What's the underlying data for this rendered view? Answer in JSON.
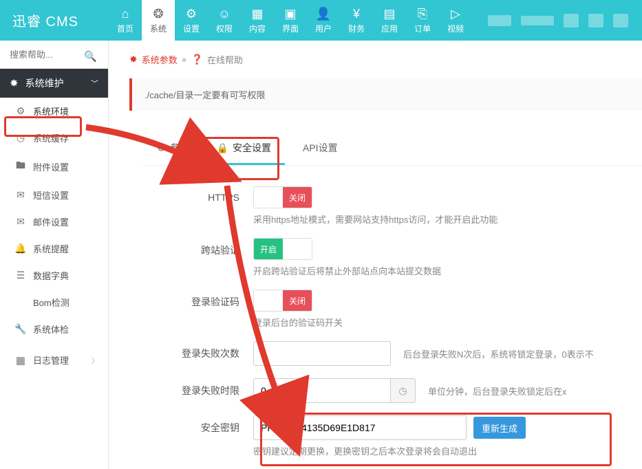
{
  "brand": "迅睿 CMS",
  "topnav": [
    {
      "icon": "⌂",
      "label": "首页"
    },
    {
      "icon": "❂",
      "label": "系统",
      "active": true
    },
    {
      "icon": "⚙",
      "label": "设置"
    },
    {
      "icon": "☺",
      "label": "权限"
    },
    {
      "icon": "▦",
      "label": "内容"
    },
    {
      "icon": "▣",
      "label": "界面"
    },
    {
      "icon": "👤",
      "label": "用户"
    },
    {
      "icon": "¥",
      "label": "财务"
    },
    {
      "icon": "▤",
      "label": "应用"
    },
    {
      "icon": "⎘",
      "label": "订单"
    },
    {
      "icon": "▷",
      "label": "视频"
    }
  ],
  "search": {
    "placeholder": "搜索帮助..."
  },
  "side_header": "系统维护",
  "sidebar_items": [
    {
      "icon": "⚙",
      "label": "系统环境",
      "active": true,
      "name": "sidebar-item-system-env"
    },
    {
      "icon": "◷",
      "label": "系统缓存",
      "name": "sidebar-item-system-cache"
    },
    {
      "icon": "🖿",
      "label": "附件设置",
      "name": "sidebar-item-attachment"
    },
    {
      "icon": "✉",
      "label": "短信设置",
      "name": "sidebar-item-sms"
    },
    {
      "icon": "✉",
      "label": "邮件设置",
      "name": "sidebar-item-email"
    },
    {
      "icon": "🔔",
      "label": "系统提醒",
      "name": "sidebar-item-notify"
    },
    {
      "icon": "☰",
      "label": "数据字典",
      "name": "sidebar-item-dict"
    },
    {
      "icon": "</>",
      "label": "Bom检测",
      "name": "sidebar-item-bom"
    },
    {
      "icon": "🔧",
      "label": "系统体检",
      "name": "sidebar-item-check"
    }
  ],
  "sidebar_log": {
    "icon": "▦",
    "label": "日志管理"
  },
  "breadcrumb": {
    "link": "系统参数",
    "help": "在线帮助"
  },
  "alert": "./cache/目录一定要有可写权限",
  "tabs": [
    {
      "icon": "⚙",
      "label": "参数",
      "name": "tab-params"
    },
    {
      "icon": "🔒",
      "label": "安全设置",
      "active": true,
      "name": "tab-security"
    },
    {
      "icon": "</>",
      "label": "API设置",
      "name": "tab-api"
    }
  ],
  "form": {
    "https": {
      "label": "HTTPS",
      "off": "关闭",
      "help": "采用https地址模式，需要网站支持https访问，才能开启此功能"
    },
    "cross": {
      "label": "跨站验证",
      "on": "开启",
      "help": "开启跨站验证后将禁止外部站点向本站提交数据"
    },
    "captcha": {
      "label": "登录验证码",
      "off": "关闭",
      "help": "登录后台的验证码开关"
    },
    "fail": {
      "label": "登录失败次数",
      "value": "0",
      "help": "后台登录失败N次后，系统将锁定登录，0表示不"
    },
    "lockout": {
      "label": "登录失败时限",
      "value": "0",
      "help": "单位分钟，后台登录失败锁定后在x"
    },
    "key": {
      "label": "安全密钥",
      "value": "PHPCMF4135D69E1D817",
      "btn": "重新生成",
      "help": "密钥建议定期更换，更换密钥之后本次登录将会自动退出"
    }
  }
}
